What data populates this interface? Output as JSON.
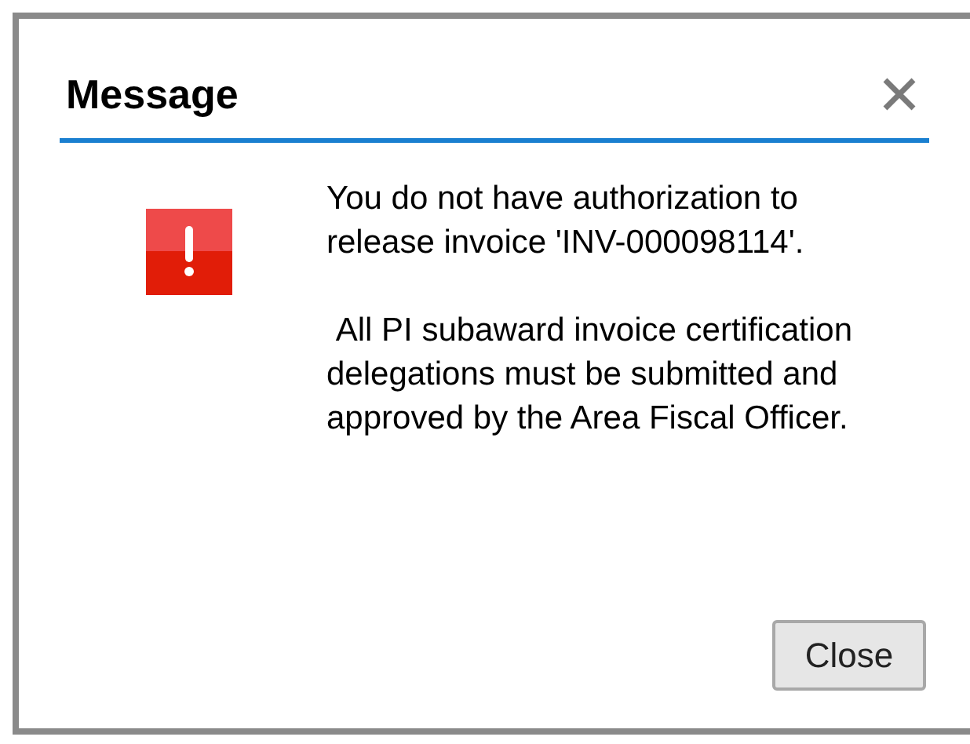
{
  "dialog": {
    "title": "Message",
    "paragraphs": [
      "You do not have authorization to release invoice 'INV-000098114'.",
      " All PI subaward invoice certification delegations must be submitted and approved by the Area Fiscal Officer."
    ],
    "buttons": [
      "Close"
    ]
  }
}
